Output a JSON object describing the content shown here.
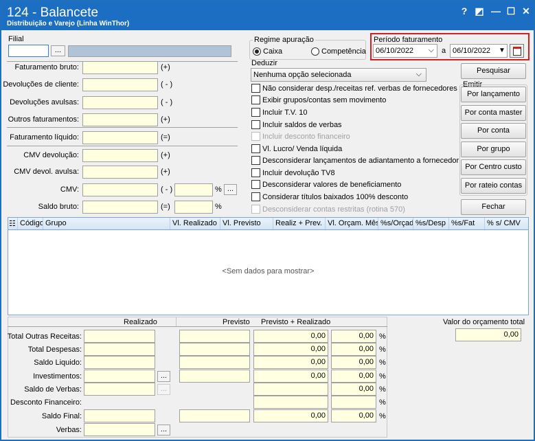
{
  "window": {
    "title": "124 - Balancete",
    "subtitle": "Distribuição e Varejo (Linha WinThor)",
    "btn_help": "?",
    "btn_restore": "◩",
    "btn_min": "—",
    "btn_max": "☐",
    "btn_close": "✕"
  },
  "filial": {
    "label": "Filial",
    "more_btn": "..."
  },
  "left_fields": [
    {
      "label": "Faturamento bruto:",
      "sign": "(+)"
    },
    {
      "label": "Devoluções de cliente:",
      "sign": "( - )"
    },
    {
      "label": "Devoluções avulsas:",
      "sign": "( - )"
    },
    {
      "label": "Outros faturamentos:",
      "sign": "(+)"
    },
    {
      "label": "Faturamento líquido:",
      "sign": "(=)"
    },
    {
      "label": "CMV devolução:",
      "sign": "(+)"
    },
    {
      "label": "CMV devol. avulsa:",
      "sign": "(+)"
    },
    {
      "label": "CMV:",
      "sign": "( - )"
    },
    {
      "label": "Saldo bruto:",
      "sign": "(=)"
    }
  ],
  "pct_symbol": "%",
  "regime": {
    "title": "Regime apuração",
    "opt1": "Caixa",
    "opt2": "Competência",
    "selected": "Caixa"
  },
  "periodo": {
    "title": "Período faturamento",
    "from": "06/10/2022",
    "to": "06/10/2022",
    "sep": "a"
  },
  "deduzir": {
    "title": "Deduzir",
    "value": "Nenhuma opção selecionada"
  },
  "checkboxes": [
    {
      "label": "Não considerar desp./receitas ref. verbas de fornecedores",
      "enabled": true
    },
    {
      "label": "Exibir grupos/contas sem movimento",
      "enabled": true
    },
    {
      "label": "Incluir T.V. 10",
      "enabled": true
    },
    {
      "label": "Incluir saldos de verbas",
      "enabled": true
    },
    {
      "label": "Incluir desconto financeiro",
      "enabled": false
    },
    {
      "label": "Vl. Lucro/ Venda líquida",
      "enabled": true
    },
    {
      "label": "Desconsiderar lançamentos de adiantamento a fornecedor",
      "enabled": true
    },
    {
      "label": "Incluir devolução TV8",
      "enabled": true
    },
    {
      "label": "Desconsiderar valores de beneficiamento",
      "enabled": true
    },
    {
      "label": "Considerar títulos baixados 100% desconto",
      "enabled": true
    },
    {
      "label": "Desconsiderar contas restritas (rotina 570)",
      "enabled": false
    }
  ],
  "buttons": {
    "pesquisar": "Pesquisar",
    "emitir_title": "Emitir",
    "por_lancamento": "Por lançamento",
    "por_conta_master": "Por conta master",
    "por_conta": "Por conta",
    "por_grupo": "Por grupo",
    "por_centro_custo": "Por Centro custo",
    "por_rateio_contas": "Por rateio contas",
    "fechar": "Fechar"
  },
  "grid": {
    "columns": [
      "Código",
      "Grupo",
      "Vl. Realizado",
      "Vl. Previsto",
      "Realiz + Prev.",
      "Vl. Orçam. Mês",
      "%s/Orçad",
      "%s/Desp",
      "%s/Fat",
      "% s/ CMV"
    ],
    "empty": "<Sem dados para mostrar>"
  },
  "summary": {
    "headers": {
      "realizado": "Realizado",
      "previsto": "Previsto",
      "prev_real": "Previsto + Realizado"
    },
    "rows": [
      {
        "label": "Total Outras Receitas:",
        "pr": "0,00",
        "pct": "0,00"
      },
      {
        "label": "Total Despesas:",
        "pr": "0,00",
        "pct": "0,00"
      },
      {
        "label": "Saldo Liquido:",
        "pr": "0,00",
        "pct": "0,00"
      },
      {
        "label": "Investimentos:",
        "pr": "0,00",
        "pct": "0,00"
      },
      {
        "label": "Saldo de Verbas:",
        "pr": "",
        "pct": "0,00"
      },
      {
        "label": "Desconto Financeiro:",
        "pr": "",
        "pct": ""
      },
      {
        "label": "Saldo Final:",
        "pr": "0,00",
        "pct": "0,00"
      },
      {
        "label": "Verbas:",
        "pr": "",
        "pct": ""
      }
    ],
    "orcamento_label": "Valor do orçamento total",
    "orcamento_value": "0,00"
  }
}
